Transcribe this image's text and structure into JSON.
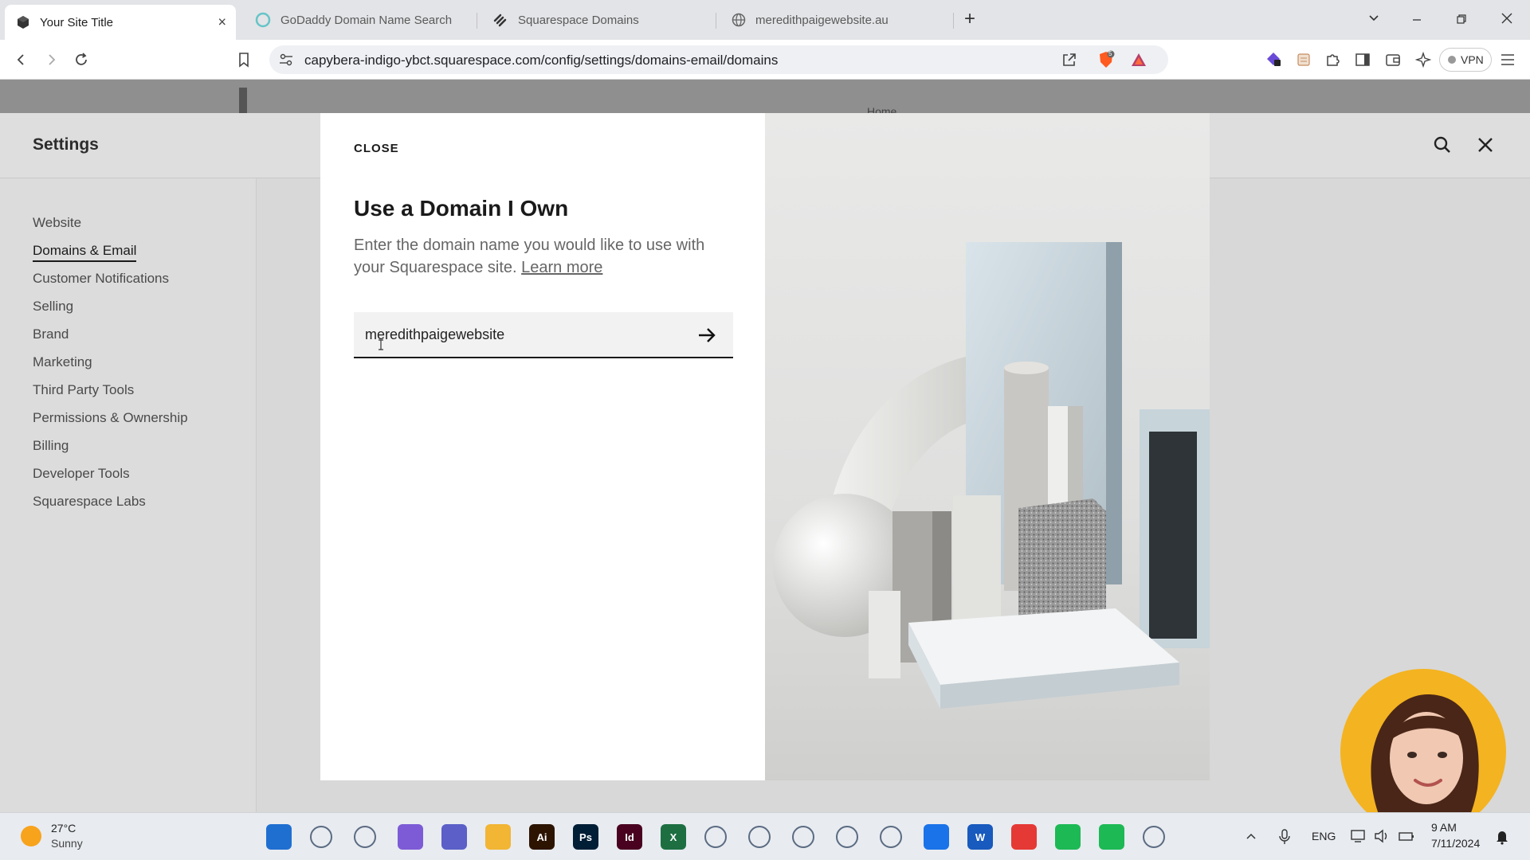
{
  "browser": {
    "tabs": [
      {
        "title": "Your Site Title",
        "active": true
      },
      {
        "title": "GoDaddy Domain Name Search",
        "active": false
      },
      {
        "title": "Squarespace Domains",
        "active": false
      },
      {
        "title": "meredithpaigewebsite.au",
        "active": false
      }
    ],
    "new_tab_label": "+",
    "url": "capybera-indigo-ybct.squarespace.com/config/settings/domains-email/domains",
    "vpn_label": "VPN",
    "shield_badge": "5"
  },
  "page": {
    "bg_peek_text": "Home"
  },
  "settings": {
    "title": "Settings",
    "nav": [
      {
        "label": "Website"
      },
      {
        "label": "Domains & Email",
        "active": true
      },
      {
        "label": "Customer Notifications"
      },
      {
        "label": "Selling"
      },
      {
        "label": "Brand"
      },
      {
        "label": "Marketing"
      },
      {
        "label": "Third Party Tools"
      },
      {
        "label": "Permissions & Ownership"
      },
      {
        "label": "Billing"
      },
      {
        "label": "Developer Tools"
      },
      {
        "label": "Squarespace Labs"
      }
    ]
  },
  "modal": {
    "close_label": "CLOSE",
    "title": "Use a Domain I Own",
    "description": "Enter the domain name you would like to use with your Squarespace site.",
    "learn_more": "Learn more",
    "domain_value": "meredithpaigewebsite"
  },
  "taskbar": {
    "weather_temp": "27°C",
    "weather_cond": "Sunny",
    "lang": "ENG",
    "time": "9 AM",
    "date": "7/11/2024",
    "apps": [
      {
        "name": "windows-start",
        "label": "",
        "color": "#1f6fd1"
      },
      {
        "name": "search",
        "label": "",
        "color": "#e8ebf0"
      },
      {
        "name": "task-view",
        "label": "",
        "color": "#e8ebf0"
      },
      {
        "name": "copilot",
        "label": "",
        "color": "#7d5bd6"
      },
      {
        "name": "teams",
        "label": "",
        "color": "#5b5fc7"
      },
      {
        "name": "file-explorer",
        "label": "",
        "color": "#f2b534"
      },
      {
        "name": "illustrator",
        "label": "Ai",
        "color": "#2c1400"
      },
      {
        "name": "photoshop",
        "label": "Ps",
        "color": "#001e36"
      },
      {
        "name": "indesign",
        "label": "Id",
        "color": "#49021f"
      },
      {
        "name": "excel",
        "label": "X",
        "color": "#1d6f42"
      },
      {
        "name": "chrome",
        "label": "",
        "color": "#e8ebf0"
      },
      {
        "name": "brave",
        "label": "",
        "color": "#e8ebf0"
      },
      {
        "name": "edge-globe",
        "label": "",
        "color": "#e8ebf0"
      },
      {
        "name": "notepad",
        "label": "",
        "color": "#e8ebf0"
      },
      {
        "name": "calculator",
        "label": "",
        "color": "#e8ebf0"
      },
      {
        "name": "docs",
        "label": "",
        "color": "#1a73e8"
      },
      {
        "name": "word",
        "label": "W",
        "color": "#185abd"
      },
      {
        "name": "video-app",
        "label": "",
        "color": "#e53935"
      },
      {
        "name": "spotify-1",
        "label": "",
        "color": "#1db954"
      },
      {
        "name": "spotify-2",
        "label": "",
        "color": "#1db954"
      },
      {
        "name": "vpn-app",
        "label": "",
        "color": "#e8ebf0"
      }
    ]
  },
  "colors": {
    "accent_dark": "#1a1a1a",
    "tab_bar": "#e3e4e7",
    "taskbar": "#e8ebf0",
    "webcam_ring": "#f4b320"
  }
}
